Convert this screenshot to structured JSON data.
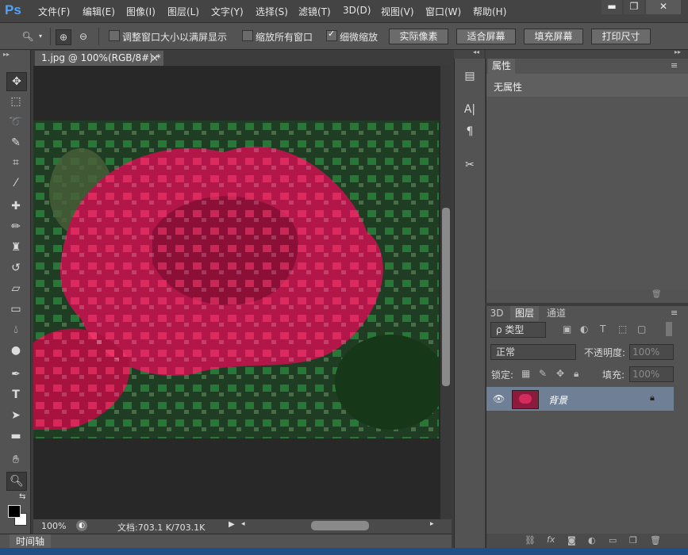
{
  "app": {
    "logo": "Ps"
  },
  "menu": [
    "文件(F)",
    "编辑(E)",
    "图像(I)",
    "图层(L)",
    "文字(Y)",
    "选择(S)",
    "滤镜(T)",
    "3D(D)",
    "视图(V)",
    "窗口(W)",
    "帮助(H)"
  ],
  "window_controls": {
    "minimize": "▬",
    "restore": "❐",
    "close": "✕"
  },
  "options": {
    "resize_windows_label": "调整窗口大小以满屏显示",
    "resize_windows_checked": false,
    "zoom_all_label": "缩放所有窗口",
    "zoom_all_checked": false,
    "scrubby_zoom_label": "细微缩放",
    "scrubby_zoom_checked": true,
    "actual_pixels": "实际像素",
    "fit_screen": "适合屏幕",
    "fill_screen": "填充屏幕",
    "print_size": "打印尺寸"
  },
  "document": {
    "tab_title": "1.jpg @ 100%(RGB/8#) *",
    "tab_close": "×",
    "zoom": "100%",
    "doc_info": "文档:703.1 K/703.1K"
  },
  "timeline": {
    "label": "时间轴"
  },
  "properties": {
    "tab": "属性",
    "empty": "无属性"
  },
  "layers_panel": {
    "tabs": [
      "3D",
      "图层",
      "通道"
    ],
    "filter_kind": "ρ 类型",
    "blend_mode": "正常",
    "opacity_label": "不透明度:",
    "opacity_value": "100%",
    "lock_label": "锁定:",
    "fill_label": "填充:",
    "fill_value": "100%",
    "layer_name": "背景"
  },
  "colors": {
    "accent": "#4aa3ff",
    "layer_selected": "#6e7f96",
    "taskbar": "#1e4f86"
  }
}
